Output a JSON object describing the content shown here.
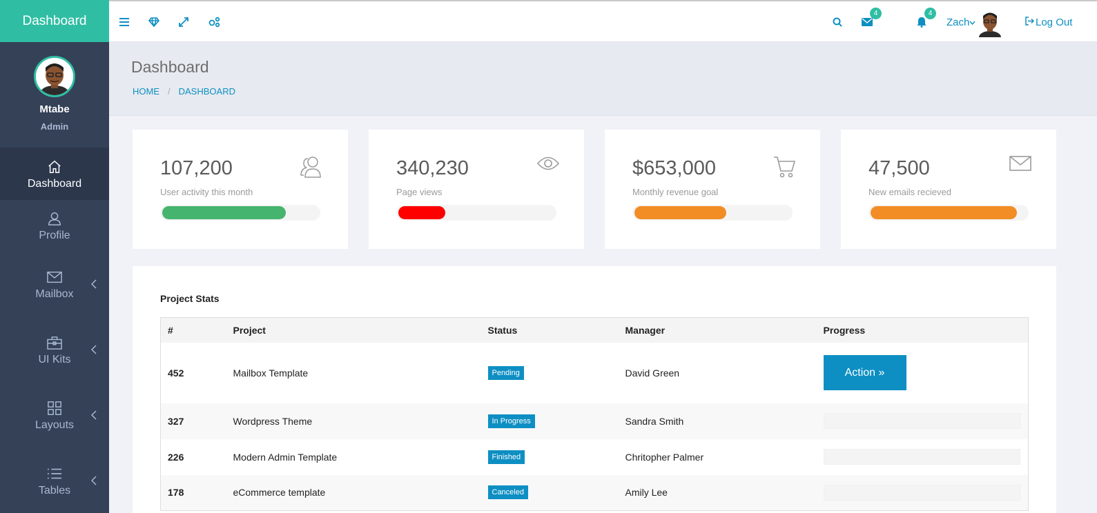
{
  "sidebar": {
    "brand": "Dashboard",
    "profile": {
      "name": "Mtabe",
      "role": "Admin"
    },
    "items": [
      {
        "label": "Dashboard",
        "icon": "home-icon"
      },
      {
        "label": "Profile",
        "icon": "user-icon"
      },
      {
        "label": "Mailbox",
        "icon": "envelope-icon"
      },
      {
        "label": "UI Kits",
        "icon": "briefcase-icon"
      },
      {
        "label": "Layouts",
        "icon": "grid-icon"
      },
      {
        "label": "Tables",
        "icon": "list-icon"
      }
    ]
  },
  "topbar": {
    "messages_count": "4",
    "notifications_count": "4",
    "user": "Zach",
    "logout": "Log Out"
  },
  "header": {
    "title": "Dashboard",
    "breadcrumb": [
      "HOME",
      "DASHBOARD"
    ]
  },
  "stats": [
    {
      "value": "107,200",
      "label": "User activity this month",
      "icon": "users-icon",
      "progress": 0.79,
      "color": "#45b46e"
    },
    {
      "value": "340,230",
      "label": "Page views",
      "icon": "eye-icon",
      "progress": 0.3,
      "color": "#ff0000"
    },
    {
      "value": "$653,000",
      "label": "Monthly revenue goal",
      "icon": "cart-icon",
      "progress": 0.59,
      "color": "#f28d26"
    },
    {
      "value": "47,500",
      "label": "New emails recieved",
      "icon": "envelope-icon",
      "progress": 0.94,
      "color": "#f28d26"
    }
  ],
  "project_stats": {
    "title": "Project Stats",
    "columns": [
      "#",
      "Project",
      "Status",
      "Manager",
      "Progress"
    ],
    "action_label": "Action »",
    "rows": [
      {
        "id": "452",
        "project": "Mailbox Template",
        "status": "Pending",
        "manager": "David Green"
      },
      {
        "id": "327",
        "project": "Wordpress Theme",
        "status": "In Progress",
        "manager": "Sandra Smith"
      },
      {
        "id": "226",
        "project": "Modern Admin Template",
        "status": "Finished",
        "manager": "Chritopher Palmer"
      },
      {
        "id": "178",
        "project": "eCommerce template",
        "status": "Canceled",
        "manager": "Amily Lee"
      }
    ]
  },
  "colors": {
    "accent": "#2fbea3",
    "sidebar": "#344157",
    "link": "#0e8fc3"
  }
}
